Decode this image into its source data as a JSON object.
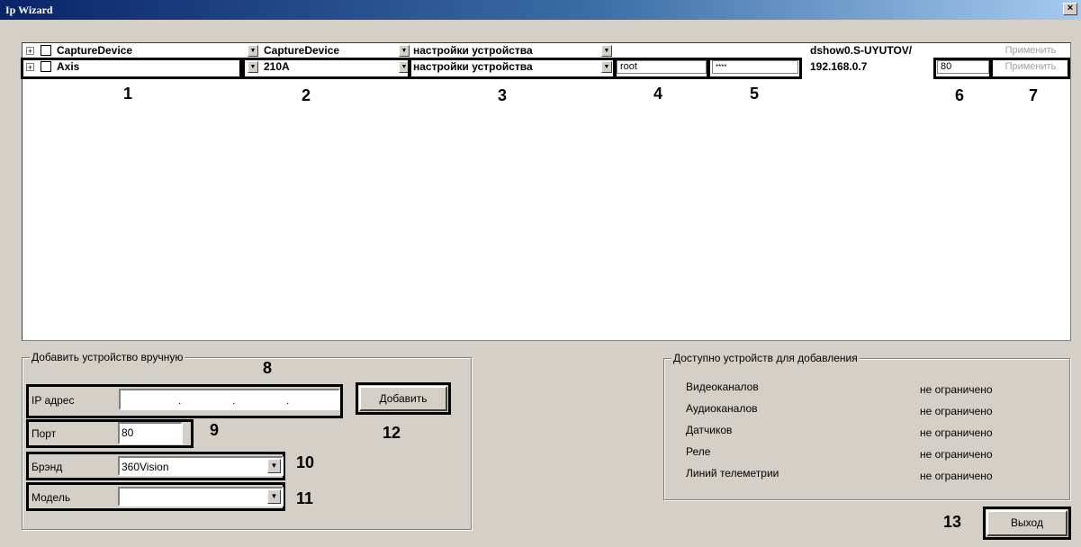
{
  "window": {
    "title": "Ip Wizard",
    "close_glyph": "×"
  },
  "grid": {
    "rows": [
      {
        "device": "CaptureDevice",
        "model": "CaptureDevice",
        "settings": "настройки устройства",
        "login": "",
        "password": "",
        "address": "dshow0.S-UYUTOV/",
        "port": "",
        "apply": "Применить"
      },
      {
        "device": "Axis",
        "model": "210A",
        "settings": "настройки устройства",
        "login": "root",
        "password": "****",
        "address": "192.168.0.7",
        "port": "80",
        "apply": "Применить"
      }
    ]
  },
  "markers": {
    "m1": "1",
    "m2": "2",
    "m3": "3",
    "m4": "4",
    "m5": "5",
    "m6": "6",
    "m7": "7",
    "m8": "8",
    "m9": "9",
    "m10": "10",
    "m11": "11",
    "m12": "12",
    "m13": "13"
  },
  "manual": {
    "title": "Добавить устройство вручную",
    "ip_label": "IP адрес",
    "ip_value": ". . .",
    "port_label": "Порт",
    "port_value": "80",
    "brand_label": "Брэнд",
    "brand_value": "360Vision",
    "model_label": "Модель",
    "model_value": "",
    "add_button": "Добавить"
  },
  "available": {
    "title": "Доступно устройств для добавления",
    "items": [
      {
        "label": "Видеоканалов",
        "value": "не ограничено"
      },
      {
        "label": "Аудиоканалов",
        "value": "не ограничено"
      },
      {
        "label": "Датчиков",
        "value": "не ограничено"
      },
      {
        "label": "Реле",
        "value": "не ограничено"
      },
      {
        "label": "Линий телеметрии",
        "value": "не ограничено"
      }
    ]
  },
  "exit_button": "Выход",
  "icons": {
    "expand": "plus-icon",
    "dropdown": "dropdown-arrow-icon",
    "close": "close-icon"
  }
}
